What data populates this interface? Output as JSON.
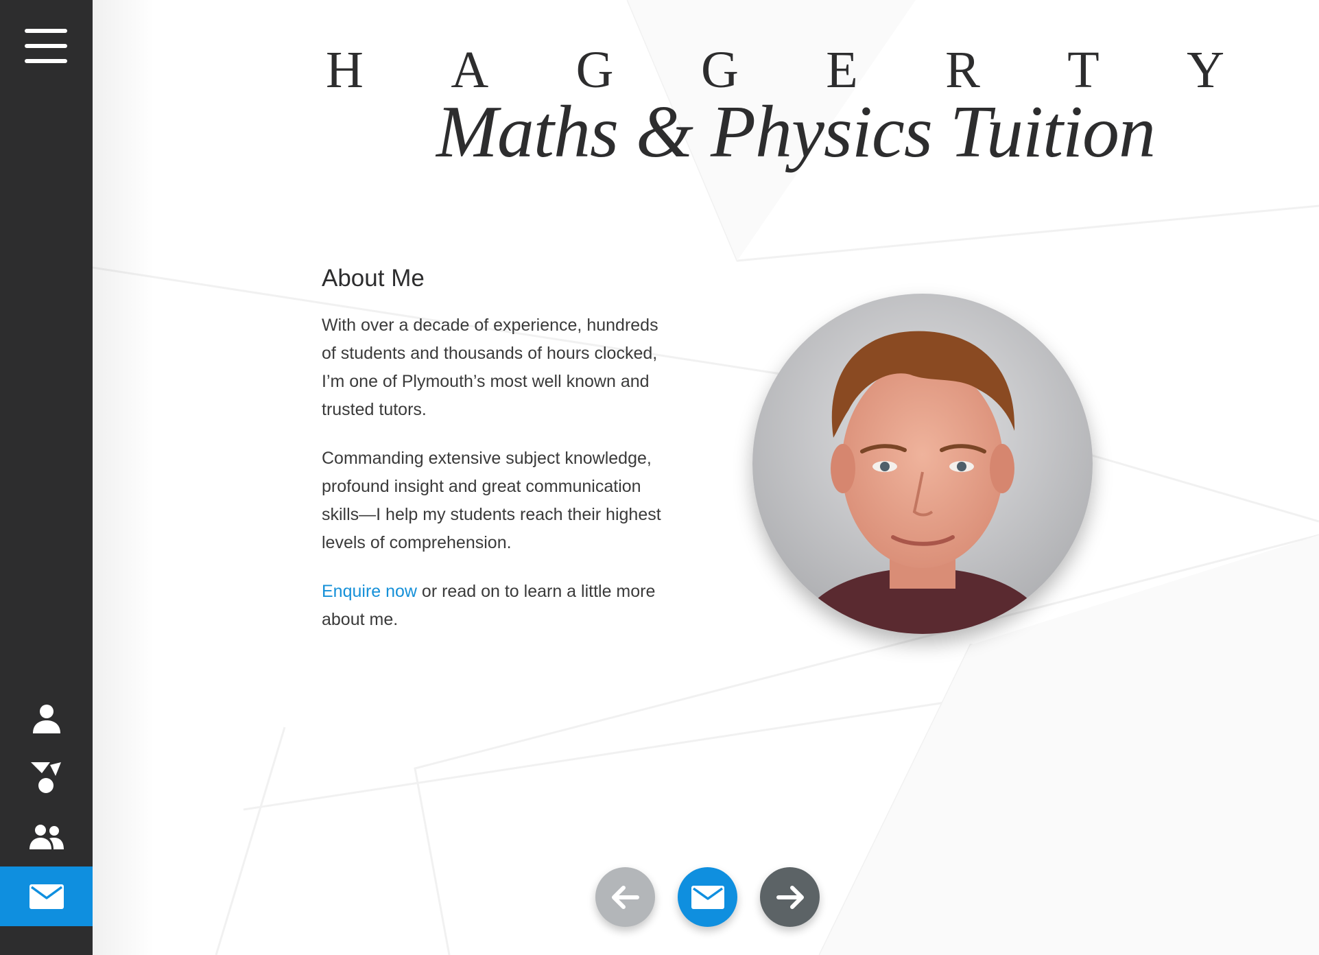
{
  "brand": {
    "name_letters": [
      "H",
      "A",
      "G",
      "G",
      "E",
      "R",
      "T",
      "Y"
    ],
    "tagline": "Maths & Physics Tuition"
  },
  "sidebar": {
    "menu_icon": "hamburger-menu-icon",
    "items": [
      {
        "id": "about",
        "icon": "person-icon",
        "active": false
      },
      {
        "id": "subjects",
        "icon": "shapes-icon",
        "active": false
      },
      {
        "id": "students",
        "icon": "group-icon",
        "active": false
      },
      {
        "id": "contact",
        "icon": "envelope-icon",
        "active": true
      }
    ]
  },
  "about": {
    "heading": "About Me",
    "paragraph1": "With over a decade of experience, hundreds of students and thousands of hours clocked, I’m one of Plymouth’s most well known and trusted tutors.",
    "paragraph2": "Commanding extensive subject knowledge, profound insight and great communication skills—I help my students reach their highest levels of comprehension.",
    "enquire_link": "Enquire now",
    "paragraph3_rest": " or read on to learn a little more about me."
  },
  "portrait": {
    "alt": "Portrait photo"
  },
  "bottom_nav": {
    "prev_icon": "arrow-left-icon",
    "mail_icon": "envelope-icon",
    "next_icon": "arrow-right-icon"
  },
  "colors": {
    "sidebar": "#2d2d2e",
    "accent": "#0f8fdf",
    "link": "#1590d8",
    "prev_button": "#b3b6b9",
    "next_button": "#5c6366"
  }
}
